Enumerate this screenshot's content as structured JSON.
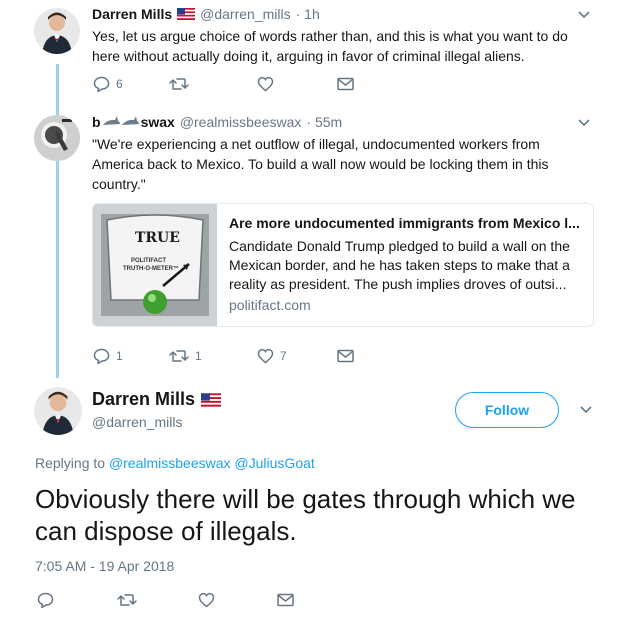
{
  "tweet1": {
    "name": "Darren Mills",
    "flag": "us-flag-icon",
    "handle": "@darren_mills",
    "time": "· 1h",
    "text": "Yes, let us argue choice of words rather than, and this is what you want to do here without actually doing it, arguing in favor of criminal illegal aliens.",
    "replies": "6",
    "retweets": "",
    "likes": ""
  },
  "tweet2": {
    "name_prefix": "b",
    "name_suffix": "swax",
    "name_emoji": "shark-icon",
    "handle": "@realmissbeeswax",
    "time": "· 55m",
    "text": "\"We're experiencing a net outflow of illegal, undocumented workers from America back to Mexico. To build a wall now would be locking them in this country.\"",
    "replies": "1",
    "retweets": "1",
    "likes": "7",
    "card": {
      "title": "Are more undocumented immigrants from Mexico l...",
      "description": "Candidate Donald Trump pledged to build a wall on the Mexican border, and he has taken steps to make that a reality as president. The push implies droves of outsi...",
      "domain": "politifact.com",
      "meter_label": "TRUE",
      "meter_brand_1": "POLITIFACT",
      "meter_brand_2": "TRUTH-O-METER™"
    }
  },
  "main_tweet": {
    "name": "Darren Mills",
    "handle": "@darren_mills",
    "follow_label": "Follow",
    "replying_prefix": "Replying to",
    "replying_to_1": "@realmissbeeswax",
    "replying_to_2": "@JuliusGoat",
    "text": "Obviously there will be gates through which we can dispose of illegals.",
    "timestamp": "7:05 AM - 19 Apr 2018"
  },
  "colors": {
    "accent": "#1da1f2",
    "muted": "#657786",
    "thread_line": "#9fd0e8"
  }
}
